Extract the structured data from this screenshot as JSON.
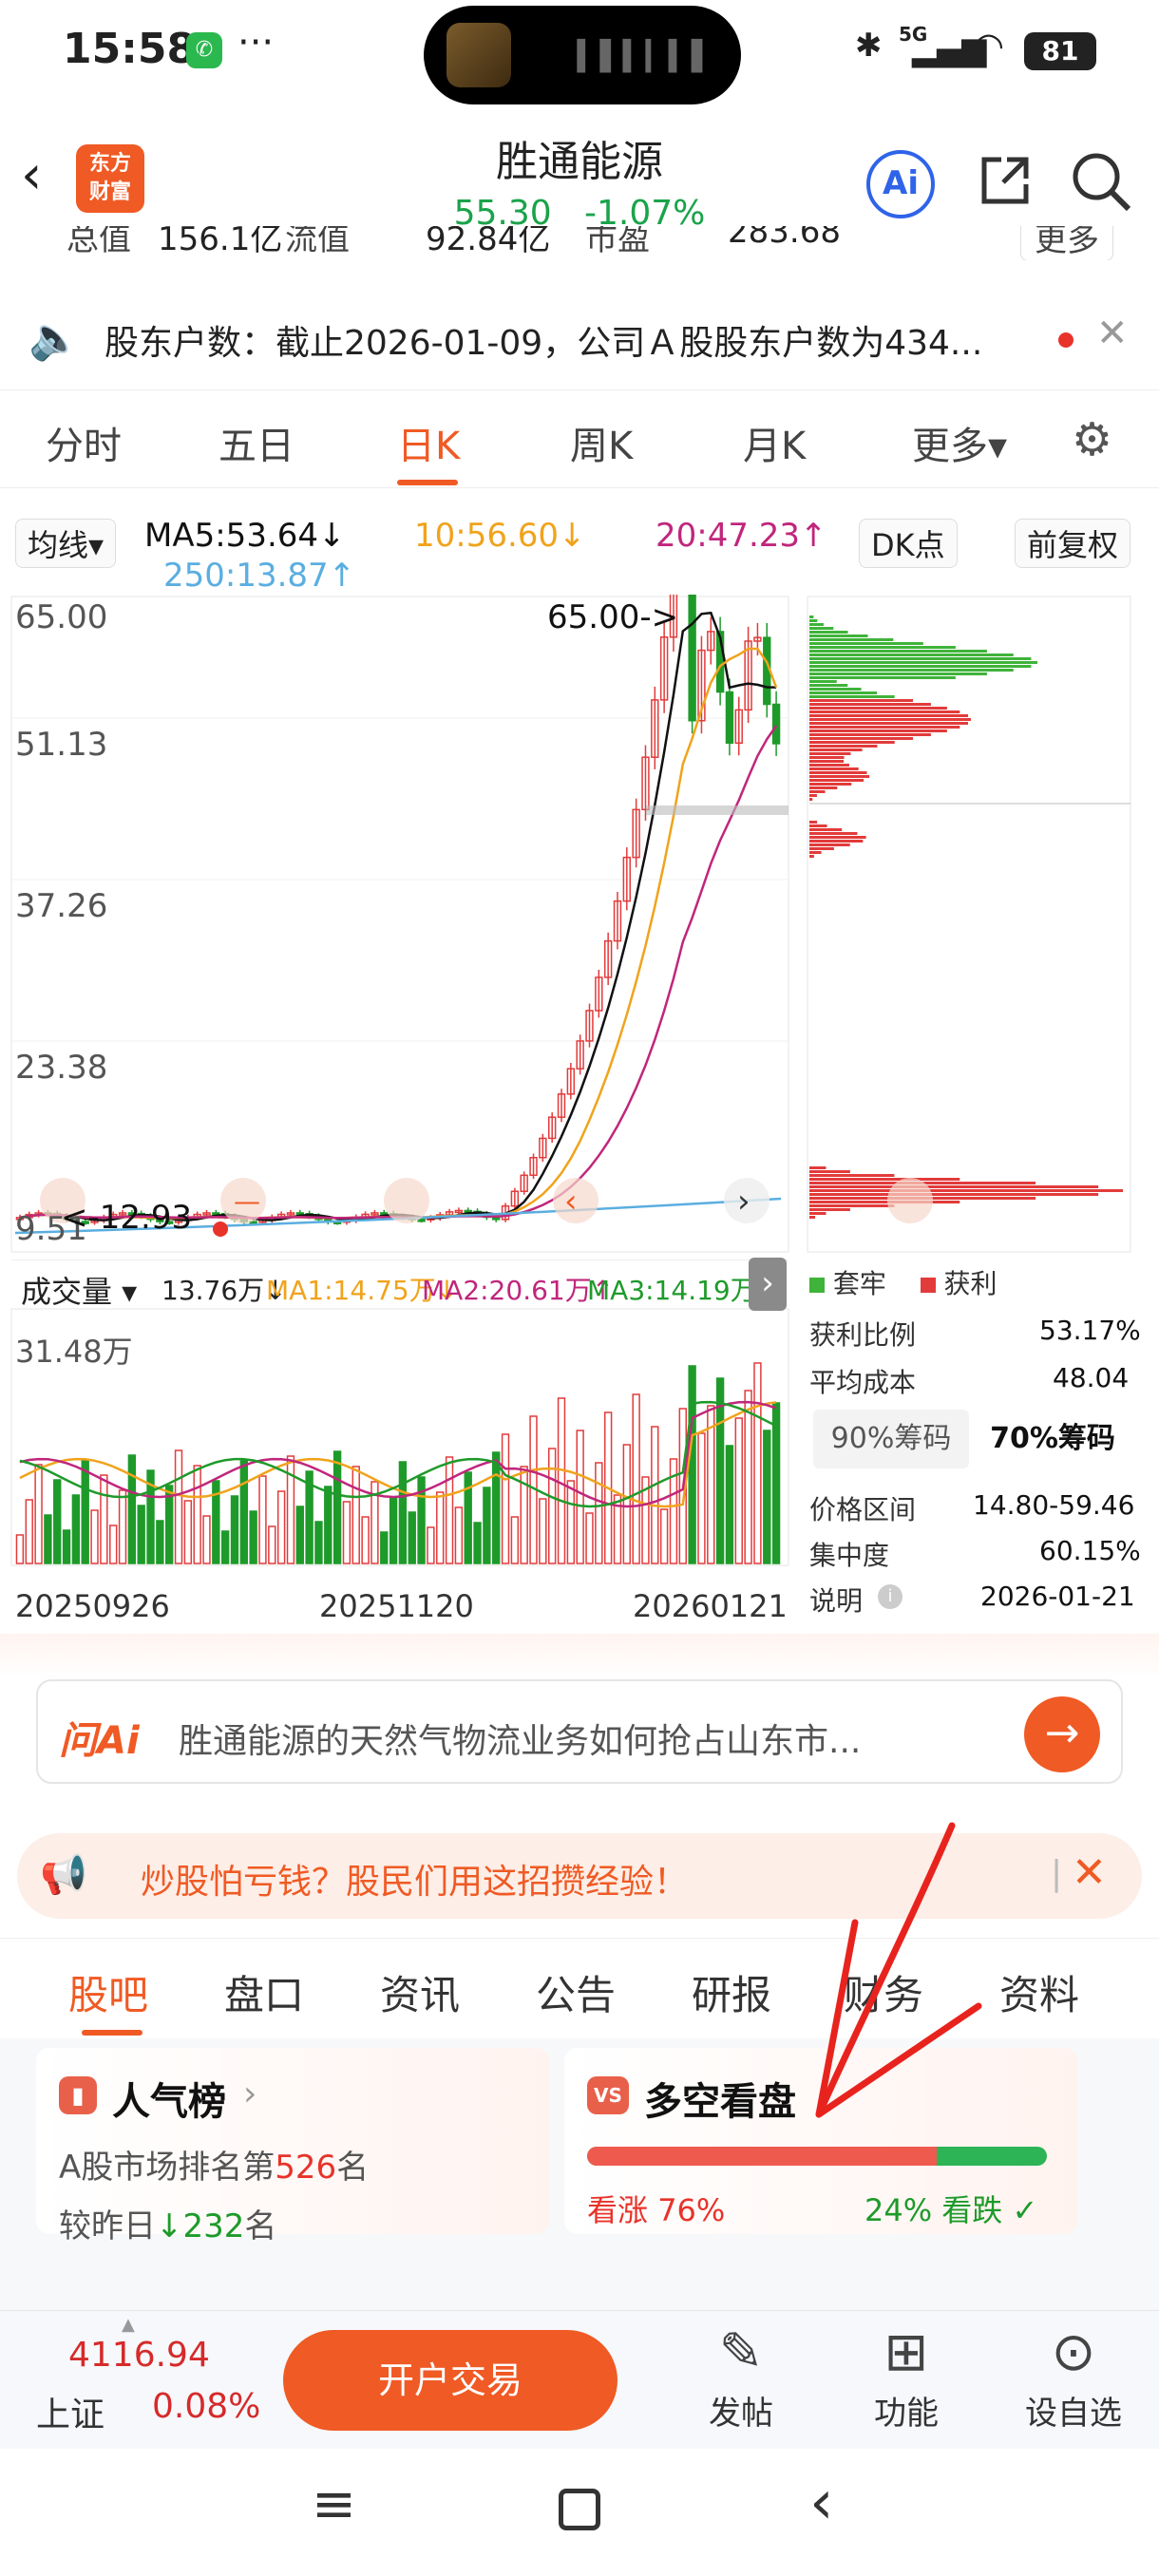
{
  "status": {
    "time": "15:58",
    "dots": "···",
    "battery": "81",
    "signal": "5G"
  },
  "header": {
    "logo_line1": "东方",
    "logo_line2": "财富",
    "title": "胜通能源",
    "price": "55.30",
    "change": "-1.07%",
    "ai_label": "Ai"
  },
  "value_strip": {
    "a": "总值",
    "b": "156.1亿",
    "c": "流值",
    "d": "92.84亿",
    "e": "市盈",
    "f": "283.68",
    "more": "更多"
  },
  "notice": {
    "text": "股东户数：截止2026-01-09，公司Ａ股股东户数为434..."
  },
  "ktabs": [
    "分时",
    "五日",
    "日K",
    "周K",
    "月K",
    "更多▾"
  ],
  "ma": {
    "type": "均线▾",
    "ma5": "MA5:53.64↓",
    "ma10": "10:56.60↓",
    "ma20": "20:47.23↑",
    "ma250": "250:13.87↑",
    "dk": "DK点",
    "fq": "前复权"
  },
  "chart_data": {
    "type": "candlestick",
    "y_ticks": [
      "65.00",
      "51.13",
      "37.26",
      "23.38",
      "9.51"
    ],
    "max_label": "65.00->",
    "min_label": "<-12.93",
    "volume_label": "成交量 ▾",
    "vol_ma": {
      "v": "13.76万↓",
      "ma1": "MA1:14.75万↓",
      "ma2": "MA2:20.61万↑",
      "ma3": "MA3:14.19万↑"
    },
    "vol_max": "31.48万",
    "x_ticks": [
      "20250926",
      "20251120",
      "20260121"
    ],
    "colors": {
      "up": "#e23b3b",
      "down": "#1e9a2a",
      "ma5": "#111111",
      "ma10": "#f0a31c",
      "ma20": "#c0267c",
      "ma250": "#5aaee0"
    }
  },
  "chips": {
    "legend_trap": "套牢",
    "legend_profit": "获利",
    "rows": [
      {
        "k": "获利比例",
        "v": "53.17%"
      },
      {
        "k": "平均成本",
        "v": "48.04"
      }
    ],
    "tab90": "90%筹码",
    "tab70": "70%筹码",
    "rows2": [
      {
        "k": "价格区间",
        "v": "14.80-59.46"
      },
      {
        "k": "集中度",
        "v": "60.15%"
      },
      {
        "k": "说明",
        "v": "2026-01-21"
      }
    ]
  },
  "ask": {
    "brand": "问Ai",
    "question": "胜通能源的天然气物流业务如何抢占山东市..."
  },
  "promo": {
    "text": "炒股怕亏钱？股民们用这招攒经验！"
  },
  "btabs": [
    "股吧",
    "盘口",
    "资讯",
    "公告",
    "研报",
    "财务",
    "资料"
  ],
  "popular": {
    "title": "人气榜",
    "rank_prefix": "A股市场排名第",
    "rank": "526",
    "rank_suffix": "名",
    "cmp_prefix": "较昨日",
    "cmp": "↓232",
    "cmp_suffix": "名"
  },
  "longshort": {
    "title": "多空看盘",
    "bull_label": "看涨",
    "bull": "76%",
    "bear": "24%",
    "bear_label": "看跌",
    "bull_pct": 76
  },
  "bottom": {
    "index_value": "4116.94",
    "index_name": "上证",
    "index_change": "0.08%",
    "open_btn": "开户交易",
    "post": "发帖",
    "func": "功能",
    "watch": "设自选"
  }
}
